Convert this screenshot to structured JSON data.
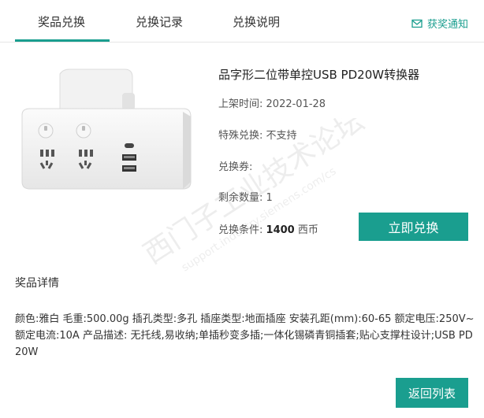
{
  "tabs": [
    {
      "label": "奖品兑换",
      "active": true
    },
    {
      "label": "兑换记录",
      "active": false
    },
    {
      "label": "兑换说明",
      "active": false
    }
  ],
  "notify": {
    "label": "获奖通知",
    "icon": "mail-icon"
  },
  "product": {
    "title": "品字形二位带单控USB PD20W转换器",
    "fields": [
      {
        "label": "上架时间:",
        "value": "2022-01-28"
      },
      {
        "label": "特殊兑换:",
        "value": "不支持"
      },
      {
        "label": "兑换券:",
        "value": ""
      },
      {
        "label": "剩余数量:",
        "value": "1"
      }
    ],
    "condition_label": "兑换条件:",
    "condition_value": "1400",
    "condition_unit": "西币",
    "redeem_button": "立即兑换"
  },
  "watermark": {
    "line1": "西门子工业技术论坛",
    "line2": "support.industry.siemens.com/cs"
  },
  "details": {
    "title": "奖品详情",
    "text": "颜色:雅白 毛重:500.00g 插孔类型:多孔 插座类型:地面插座 安装孔距(mm):60-65 额定电压:250V~ 额定电流:10A 产品描述: 无托线,易收纳;单插秒变多插;一体化锡磷青铜插套;贴心支撑柱设计;USB PD 20W"
  },
  "back_button": "返回列表",
  "colors": {
    "accent": "#1a9e8f"
  }
}
